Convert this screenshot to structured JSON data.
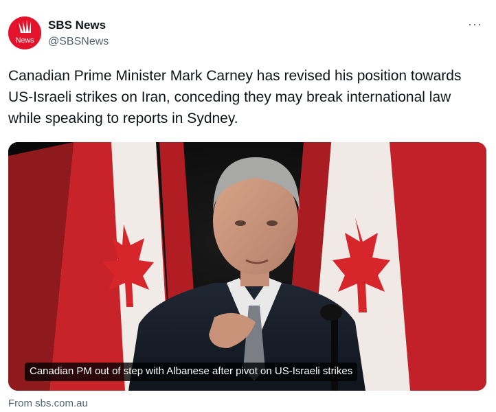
{
  "account": {
    "display_name": "SBS News",
    "handle": "@SBSNews",
    "avatar_text": "News",
    "avatar_color": "#e3132c"
  },
  "more_label": "···",
  "tweet_text": "Canadian Prime Minister Mark Carney has revised his position towards US-Israeli strikes on Iran, conceding they may break international law while speaking to reports in Sydney.",
  "card": {
    "caption": "Canadian PM out of step with Albanese after pivot on US-Israeli strikes",
    "source": "From sbs.com.au"
  },
  "colors": {
    "flag_red": "#d7262b",
    "text_primary": "#0f1419",
    "text_secondary": "#536471"
  }
}
